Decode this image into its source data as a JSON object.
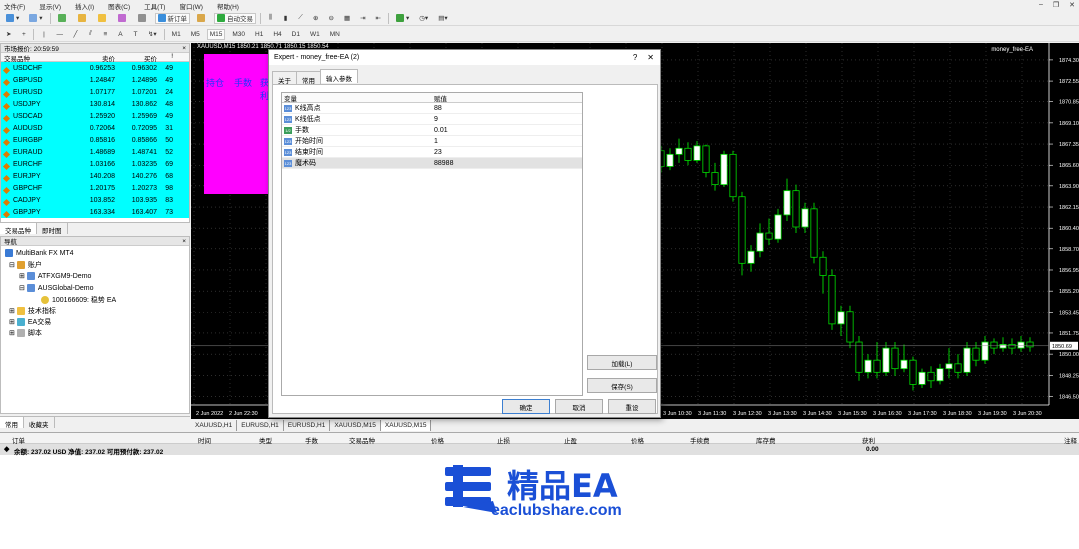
{
  "menu": [
    "文件(F)",
    "显示(V)",
    "插入(I)",
    "图表(C)",
    "工具(T)",
    "窗口(W)",
    "帮助(H)"
  ],
  "toolbar": {
    "new_order": "新订单",
    "auto_trading": "自动交易",
    "timeframes": [
      "M1",
      "M5",
      "M15",
      "M30",
      "H1",
      "H4",
      "D1",
      "W1",
      "MN"
    ]
  },
  "market_watch": {
    "title": "市场报价: 20:59:59",
    "columns": [
      "交易品种",
      "卖价",
      "买价",
      "!"
    ],
    "rows": [
      {
        "symbol": "USDCHF",
        "bid": "0.96253",
        "ask": "0.96302",
        "spread": "49"
      },
      {
        "symbol": "GBPUSD",
        "bid": "1.24847",
        "ask": "1.24896",
        "spread": "49"
      },
      {
        "symbol": "EURUSD",
        "bid": "1.07177",
        "ask": "1.07201",
        "spread": "24"
      },
      {
        "symbol": "USDJPY",
        "bid": "130.814",
        "ask": "130.862",
        "spread": "48"
      },
      {
        "symbol": "USDCAD",
        "bid": "1.25920",
        "ask": "1.25969",
        "spread": "49"
      },
      {
        "symbol": "AUDUSD",
        "bid": "0.72064",
        "ask": "0.72095",
        "spread": "31"
      },
      {
        "symbol": "EURGBP",
        "bid": "0.85816",
        "ask": "0.85866",
        "spread": "50"
      },
      {
        "symbol": "EURAUD",
        "bid": "1.48689",
        "ask": "1.48741",
        "spread": "52"
      },
      {
        "symbol": "EURCHF",
        "bid": "1.03166",
        "ask": "1.03235",
        "spread": "69"
      },
      {
        "symbol": "EURJPY",
        "bid": "140.208",
        "ask": "140.276",
        "spread": "68"
      },
      {
        "symbol": "GBPCHF",
        "bid": "1.20175",
        "ask": "1.20273",
        "spread": "98"
      },
      {
        "symbol": "CADJPY",
        "bid": "103.852",
        "ask": "103.935",
        "spread": "83"
      },
      {
        "symbol": "GBPJPY",
        "bid": "163.334",
        "ask": "163.407",
        "spread": "73"
      }
    ],
    "tabs": [
      "交易品种",
      "即时图"
    ]
  },
  "navigator": {
    "title": "导航",
    "items": [
      "MultiBank FX MT4",
      "账户",
      "ATFXGM9-Demo",
      "AUSGlobal-Demo",
      "100166609: 稳势 EA",
      "技术指标",
      "EA交易",
      "脚本"
    ],
    "tabs": [
      "常用",
      "收藏夹"
    ]
  },
  "chart": {
    "symbol_info": "XAUUSD,M15  1850.21 1850.71 1850.15 1850.54",
    "ea_label": "money_free-EA",
    "overlay_text1": "持仓",
    "overlay_text2": "手数",
    "overlay_text3": "获利",
    "price_labels": [
      "1874.30",
      "1872.55",
      "1870.85",
      "1869.10",
      "1867.35",
      "1865.60",
      "1863.90",
      "1862.15",
      "1860.40",
      "1858.70",
      "1856.95",
      "1855.20",
      "1853.45",
      "1851.75",
      "1850.00",
      "1848.25",
      "1846.50"
    ],
    "current_price": "1850.69",
    "time_labels": [
      "2 Jun 2022",
      "2 Jun 22:30",
      "3 Jun 10:30",
      "3 Jun 11:30",
      "3 Jun 12:30",
      "3 Jun 13:30",
      "3 Jun 14:30",
      "3 Jun 15:30",
      "3 Jun 16:30",
      "3 Jun 17:30",
      "3 Jun 18:30",
      "3 Jun 19:30",
      "3 Jun 20:30"
    ]
  },
  "chart_tabs": [
    "XAUUSD,H1",
    "EURUSD,H1",
    "EURUSD,H1",
    "XAUUSD,M15",
    "XAUUSD,M15"
  ],
  "terminal": {
    "columns": [
      "订单",
      "时间",
      "类型",
      "手数",
      "交易品种",
      "价格",
      "止损",
      "止盈",
      "价格",
      "手续费",
      "库存费",
      "获利",
      "注释"
    ],
    "balance": "余额: 237.02 USD  净值: 237.02  可用预付款: 237.02",
    "profit": "0.00"
  },
  "dialog": {
    "title": "Expert - money_free-EA (2)",
    "tabs": [
      "关于",
      "常用",
      "输入参数"
    ],
    "grid_headers": [
      "变量",
      "赋值"
    ],
    "params": [
      {
        "name": "K线高点",
        "value": "88",
        "icon": "123"
      },
      {
        "name": "K线低点",
        "value": "9",
        "icon": "123"
      },
      {
        "name": "手数",
        "value": "0.01",
        "icon": "1/2"
      },
      {
        "name": "开始时间",
        "value": "1",
        "icon": "123"
      },
      {
        "name": "结束时间",
        "value": "23",
        "icon": "123"
      },
      {
        "name": "魔术码",
        "value": "88988",
        "icon": "123"
      }
    ],
    "load_btn": "加载(L)",
    "save_btn": "保存(S)",
    "ok_btn": "确定",
    "cancel_btn": "取消",
    "reset_btn": "重设"
  },
  "watermark": {
    "title": "精品EA",
    "url": "eaclubshare.com"
  },
  "candles": [
    {
      "o": 1866.8,
      "c": 1865.5,
      "h": 1867.2,
      "l": 1865.0
    },
    {
      "o": 1865.5,
      "c": 1866.5,
      "h": 1867.0,
      "l": 1865.2
    },
    {
      "o": 1866.5,
      "c": 1867.0,
      "h": 1867.8,
      "l": 1865.8
    },
    {
      "o": 1867.0,
      "c": 1866.0,
      "h": 1867.5,
      "l": 1865.6
    },
    {
      "o": 1866.0,
      "c": 1867.2,
      "h": 1867.6,
      "l": 1865.8
    },
    {
      "o": 1867.2,
      "c": 1865.0,
      "h": 1867.3,
      "l": 1864.6
    },
    {
      "o": 1865.0,
      "c": 1864.0,
      "h": 1865.8,
      "l": 1863.5
    },
    {
      "o": 1864.0,
      "c": 1866.5,
      "h": 1866.8,
      "l": 1863.8
    },
    {
      "o": 1866.5,
      "c": 1863.0,
      "h": 1866.8,
      "l": 1862.6
    },
    {
      "o": 1863.0,
      "c": 1857.5,
      "h": 1863.4,
      "l": 1856.5
    },
    {
      "o": 1857.5,
      "c": 1858.5,
      "h": 1859.0,
      "l": 1856.8
    },
    {
      "o": 1858.5,
      "c": 1860.0,
      "h": 1860.8,
      "l": 1858.0
    },
    {
      "o": 1860.0,
      "c": 1859.5,
      "h": 1861.2,
      "l": 1859.0
    },
    {
      "o": 1859.5,
      "c": 1861.5,
      "h": 1862.0,
      "l": 1859.2
    },
    {
      "o": 1861.5,
      "c": 1863.5,
      "h": 1864.5,
      "l": 1861.0
    },
    {
      "o": 1863.5,
      "c": 1860.5,
      "h": 1864.0,
      "l": 1860.0
    },
    {
      "o": 1860.5,
      "c": 1862.0,
      "h": 1862.5,
      "l": 1860.0
    },
    {
      "o": 1862.0,
      "c": 1858.0,
      "h": 1862.5,
      "l": 1857.5
    },
    {
      "o": 1858.0,
      "c": 1856.5,
      "h": 1858.5,
      "l": 1855.0
    },
    {
      "o": 1856.5,
      "c": 1852.5,
      "h": 1857.0,
      "l": 1852.0
    },
    {
      "o": 1852.5,
      "c": 1853.5,
      "h": 1854.0,
      "l": 1851.5
    },
    {
      "o": 1853.5,
      "c": 1851.0,
      "h": 1854.0,
      "l": 1850.5
    },
    {
      "o": 1851.0,
      "c": 1848.5,
      "h": 1851.5,
      "l": 1847.8
    },
    {
      "o": 1848.5,
      "c": 1849.5,
      "h": 1850.0,
      "l": 1848.0
    },
    {
      "o": 1849.5,
      "c": 1848.5,
      "h": 1851.0,
      "l": 1848.0
    },
    {
      "o": 1848.5,
      "c": 1850.5,
      "h": 1851.0,
      "l": 1848.2
    },
    {
      "o": 1850.5,
      "c": 1848.8,
      "h": 1851.0,
      "l": 1848.2
    },
    {
      "o": 1848.8,
      "c": 1849.5,
      "h": 1850.8,
      "l": 1848.5
    },
    {
      "o": 1849.5,
      "c": 1847.5,
      "h": 1849.8,
      "l": 1847.0
    },
    {
      "o": 1847.5,
      "c": 1848.5,
      "h": 1848.8,
      "l": 1847.2
    },
    {
      "o": 1848.5,
      "c": 1847.8,
      "h": 1849.0,
      "l": 1847.2
    },
    {
      "o": 1847.8,
      "c": 1848.8,
      "h": 1849.2,
      "l": 1847.5
    },
    {
      "o": 1848.8,
      "c": 1849.2,
      "h": 1850.5,
      "l": 1848.0
    },
    {
      "o": 1849.2,
      "c": 1848.5,
      "h": 1850.0,
      "l": 1848.0
    },
    {
      "o": 1848.5,
      "c": 1850.5,
      "h": 1851.0,
      "l": 1848.2
    },
    {
      "o": 1850.5,
      "c": 1849.5,
      "h": 1851.0,
      "l": 1849.0
    },
    {
      "o": 1849.5,
      "c": 1851.0,
      "h": 1851.5,
      "l": 1849.2
    },
    {
      "o": 1851.0,
      "c": 1850.5,
      "h": 1851.3,
      "l": 1850.0
    },
    {
      "o": 1850.5,
      "c": 1850.8,
      "h": 1851.4,
      "l": 1850.2
    },
    {
      "o": 1850.8,
      "c": 1850.5,
      "h": 1851.3,
      "l": 1850.0
    },
    {
      "o": 1850.5,
      "c": 1851.0,
      "h": 1851.5,
      "l": 1850.2
    },
    {
      "o": 1851.0,
      "c": 1850.6,
      "h": 1851.4,
      "l": 1850.2
    }
  ],
  "colors": {
    "market_bg": "#00ffff",
    "chart_bg": "#000000",
    "bull": "#ffffff",
    "bear": "#000000",
    "wick": "#00dd00",
    "magenta": "#ff00ff",
    "accent": "#1a4fd6"
  }
}
